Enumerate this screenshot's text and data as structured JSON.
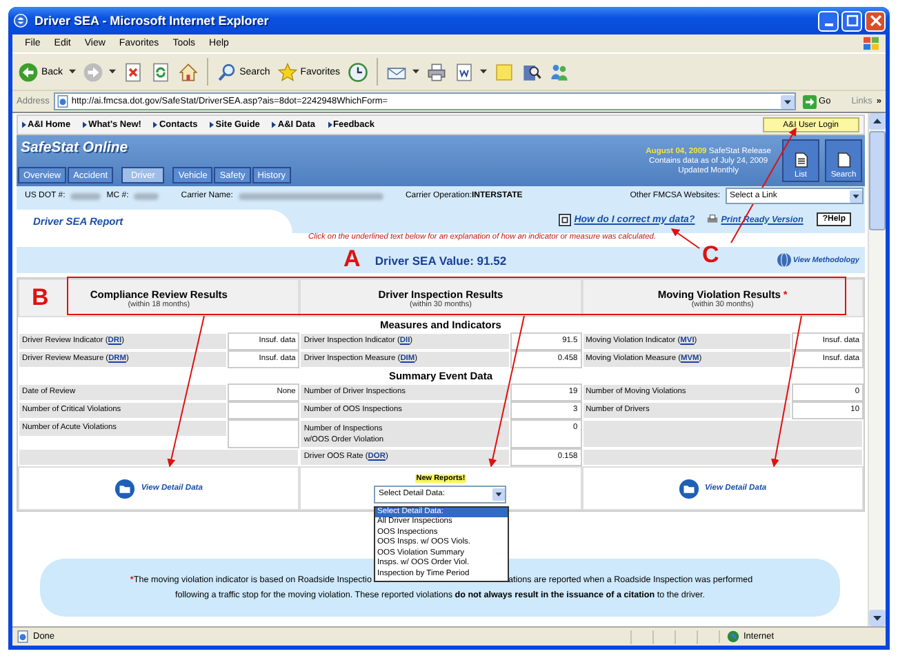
{
  "window": {
    "title": "Driver SEA - Microsoft Internet Explorer"
  },
  "menu": [
    "File",
    "Edit",
    "View",
    "Favorites",
    "Tools",
    "Help"
  ],
  "toolbar": [
    [
      {
        "kind": "back",
        "label": "Back",
        "dropdown": true
      },
      {
        "kind": "forward",
        "dropdown": true
      },
      {
        "kind": "stop",
        "dropdown": false
      },
      {
        "kind": "refresh",
        "dropdown": false
      },
      {
        "kind": "home",
        "dropdown": false
      }
    ],
    [
      {
        "kind": "search",
        "label": "Search",
        "dropdown": false
      },
      {
        "kind": "favorites",
        "label": "Favorites",
        "dropdown": false
      },
      {
        "kind": "history",
        "dropdown": false
      }
    ],
    [
      {
        "kind": "mail",
        "dropdown": true
      },
      {
        "kind": "print",
        "dropdown": false
      },
      {
        "kind": "edit",
        "dropdown": true
      },
      {
        "kind": "notes",
        "dropdown": false
      },
      {
        "kind": "research",
        "dropdown": false
      },
      {
        "kind": "messenger",
        "dropdown": false
      }
    ]
  ],
  "address": {
    "label": "Address",
    "url": "http://ai.fmcsa.dot.gov/SafeStat/DriverSEA.asp?ais=8dot=2242948WhichForm=",
    "go": "Go",
    "links": "Links",
    "more": "»"
  },
  "site_links": [
    "A&I Home",
    "What's New!",
    "Contacts",
    "Site Guide",
    "A&I Data",
    "Feedback"
  ],
  "login": "A&I User Login",
  "header": {
    "title": "SafeStat Online",
    "tabs": [
      {
        "label": "Overview",
        "selected": false
      },
      {
        "label": "Accident",
        "selected": false
      },
      {
        "label": "Driver",
        "selected": true
      },
      {
        "label": "Vehicle",
        "selected": false
      },
      {
        "label": "Safety",
        "selected": false
      },
      {
        "label": "History",
        "selected": false
      }
    ],
    "release_date": "August 04, 2009",
    "release_label": "SafeStat Release",
    "data_as_of": "Contains data as of July 24, 2009",
    "updated": "Updated Monthly",
    "buttons": [
      "List",
      "Search"
    ]
  },
  "carrier": {
    "dot_label": "US DOT #:",
    "mc_label": "MC #:",
    "name_label": "Carrier Name:",
    "operation_label": "Carrier Operation:",
    "operation": "INTERSTATE",
    "websites_label": "Other FMCSA Websites:",
    "websites_select": "Select a Link"
  },
  "report": {
    "title": "Driver SEA Report",
    "correct_link": "How do I correct my data?",
    "print_link": "Print Ready Version",
    "help": "?Help",
    "instruction": "Click on the underlined text below for an explanation of how an indicator or measure was calculated.",
    "sea_value": "Driver SEA Value: 91.52",
    "methodology": "View Methodology"
  },
  "columns": [
    {
      "title": "Compliance Review Results",
      "period": "(within 18 months)"
    },
    {
      "title": "Driver Inspection Results",
      "period": "(within 30 months)"
    },
    {
      "title": "Moving Violation Results",
      "period": "(within 30 months)",
      "mark": "*"
    }
  ],
  "sections": [
    {
      "title": "Measures and Indicators",
      "rows": [
        [
          {
            "kind": "field",
            "label": "Driver Review Indicator (",
            "link": "DRI",
            "suffix": ")",
            "value": "Insuf. data"
          },
          {
            "kind": "field",
            "label": "Driver Inspection Indicator (",
            "link": "DII",
            "suffix": ")",
            "value": "91.5"
          },
          {
            "kind": "field",
            "label": "Moving Violation Indicator (",
            "link": "MVI",
            "suffix": ")",
            "value": "Insuf. data"
          }
        ],
        [
          {
            "kind": "field",
            "label": "Driver Review Measure (",
            "link": "DRM",
            "suffix": ")",
            "value": "Insuf. data"
          },
          {
            "kind": "field",
            "label": "Driver Inspection Measure (",
            "link": "DIM",
            "suffix": ")",
            "value": "0.458"
          },
          {
            "kind": "field",
            "label": "Moving Violation Measure (",
            "link": "MVM",
            "suffix": ")",
            "value": "Insuf. data"
          }
        ]
      ]
    },
    {
      "title": "Summary Event Data",
      "rows": [
        [
          {
            "kind": "field",
            "label": "Date of Review",
            "value": "None"
          },
          {
            "kind": "field",
            "label": "Number of Driver Inspections",
            "value": "19"
          },
          {
            "kind": "field",
            "label": "Number of Moving Violations",
            "value": "0"
          }
        ],
        [
          {
            "kind": "field",
            "label": "Number of Critical Violations"
          },
          {
            "kind": "field",
            "label": "Number of OOS Inspections",
            "value": "3"
          },
          {
            "kind": "field",
            "label": "Number of Drivers",
            "value": "10"
          }
        ],
        [
          {
            "kind": "field",
            "label": "Number of Acute Violations"
          },
          {
            "kind": "field",
            "label": "Number of Inspections\nw/OOS Order Violation",
            "value": "0"
          },
          {
            "kind": "blank"
          }
        ],
        [
          {
            "kind": "blank"
          },
          {
            "kind": "field",
            "label": "Driver OOS Rate (",
            "link": "DOR",
            "suffix": ")",
            "value": "0.158"
          },
          {
            "kind": "blank"
          }
        ]
      ]
    }
  ],
  "details": [
    {
      "kind": "link",
      "label": "View Detail Data"
    },
    {
      "kind": "select",
      "badge": "New Reports!",
      "value": "Select Detail Data:",
      "options": [
        {
          "label": "Select Detail Data:",
          "selected": true
        },
        {
          "label": "All Driver Inspections",
          "selected": false
        },
        {
          "label": "OOS Inspections",
          "selected": false
        },
        {
          "label": "OOS Insps. w/ OOS Viols.",
          "selected": false
        },
        {
          "label": "OOS Violation Summary",
          "selected": false
        },
        {
          "label": "Insps. w/ OOS Order Viol.",
          "selected": false
        },
        {
          "label": "Inspection by Time Period",
          "selected": false
        }
      ]
    },
    {
      "kind": "link",
      "label": "View Detail Data"
    }
  ],
  "footnote": {
    "mark": "*",
    "line1_start": "The moving violation indicator is based on Roadside Inspectio",
    "line1_end": "ations are reported when a Roadside Inspection was performed",
    "line2": "following a traffic stop for the moving violation. These reported violations **do not always result in the issuance of a citation** to the driver."
  },
  "annotations": {
    "a": "A",
    "b": "B",
    "c": "C"
  },
  "status": {
    "text": "Done",
    "zone": "Internet"
  }
}
